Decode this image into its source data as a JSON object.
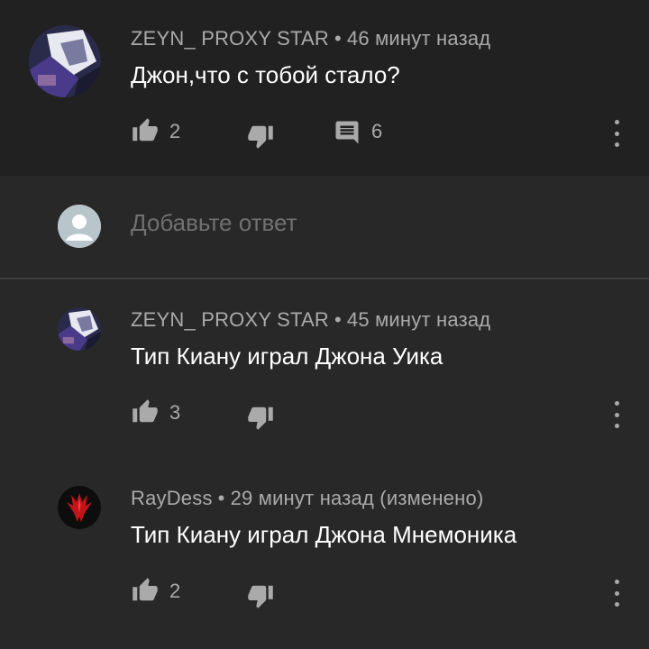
{
  "comments": [
    {
      "author": "ZEYN_ PROXY STAR",
      "time": "46 минут назад",
      "text": "Джон,что с тобой стало?",
      "likes": "2",
      "replies": "6"
    },
    {
      "author": "ZEYN_ PROXY STAR",
      "time": "45 минут назад",
      "text": "Тип Киану играл Джона Уика",
      "likes": "3"
    },
    {
      "author": "RayDess",
      "time": "29 минут назад (изменено)",
      "text": "Тип Киану играл Джона Мнемоника",
      "likes": "2"
    }
  ],
  "reply_box": {
    "placeholder": "Добавьте ответ"
  },
  "separator": "•",
  "colors": {
    "background": "#282828",
    "top_comment_background": "#212121",
    "meta_text": "#aaaaaa",
    "icon": "#aaaaaa"
  }
}
